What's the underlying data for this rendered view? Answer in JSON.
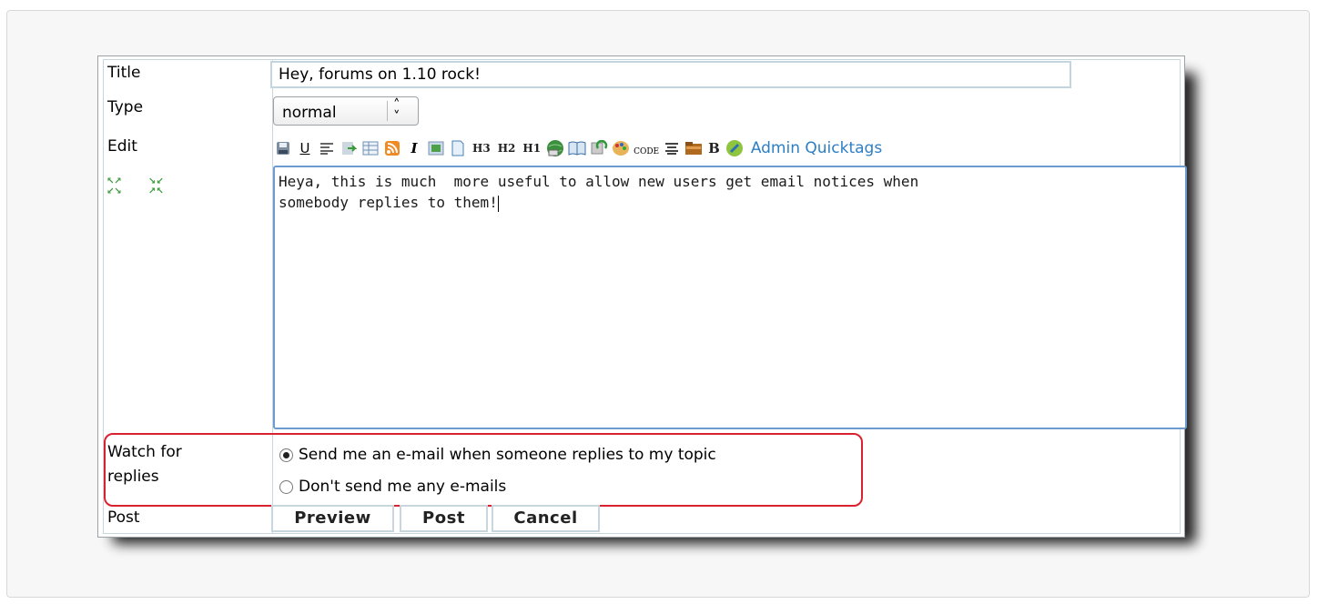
{
  "form": {
    "title_label": "Title",
    "title_value": "Hey, forums on 1.10 rock!",
    "type_label": "Type",
    "type_value": "normal",
    "edit_label": "Edit",
    "admin_quicktags": "Admin Quicktags",
    "toolbar_text": {
      "h3": "H3",
      "h2": "H2",
      "h1": "H1",
      "italic": "I",
      "underline": "U",
      "bold": "B",
      "code": "CODE"
    },
    "editor_text": "Heya, this is much  more useful to allow new users get email notices when\nsomebody replies to them!",
    "watch_label": "Watch for\nreplies",
    "watch_option_send": "Send me an e-mail when someone replies to my topic",
    "watch_option_none": "Don't send me any e-mails",
    "watch_selected": "send",
    "post_label": "Post",
    "preview_button": "Preview",
    "post_button": "Post",
    "cancel_button": "Cancel"
  },
  "colors": {
    "highlight": "#d9212f",
    "link": "#2d7fc4",
    "editor_border": "#6d9bcf"
  }
}
